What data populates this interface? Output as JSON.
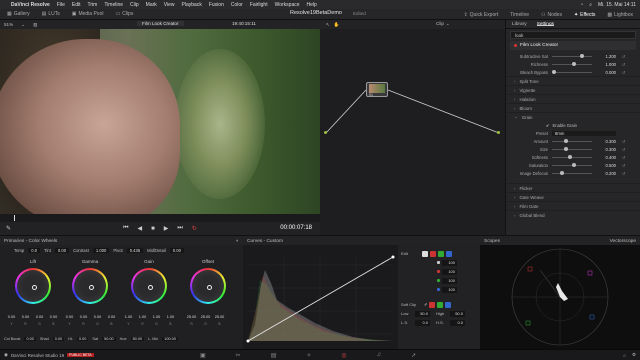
{
  "menubar": {
    "app": "DaVinci Resolve",
    "items": [
      "File",
      "Edit",
      "Trim",
      "Timeline",
      "Clip",
      "Mark",
      "View",
      "Playback",
      "Fusion",
      "Color",
      "Fairlight",
      "Workspace",
      "Help"
    ],
    "datetime": "Mi. 15. Mai 14:11"
  },
  "tabs": {
    "left": [
      "Gallery",
      "LUTs",
      "Media Pool",
      "Clips"
    ],
    "project_title": "Resolve19BetaDemo",
    "project_sub": "Edited",
    "right": [
      "Quick Export",
      "Timeline",
      "Nodes",
      "Effects",
      "Lightbox"
    ]
  },
  "viewer": {
    "zoom": "51%",
    "clip_name": "Film Look Creator",
    "timecode": "19:40:15:11",
    "playhead_tc": "00:00:07:18"
  },
  "nodes": {
    "clip_label": "Clip",
    "node_id": "01"
  },
  "panel": {
    "tabs": [
      "Library",
      "Settings"
    ],
    "search": "look",
    "effect_title": "Film Look Creator",
    "top_params": [
      {
        "label": "Subtractive Sat",
        "value": "1.200"
      },
      {
        "label": "Richness",
        "value": "1.000"
      },
      {
        "label": "Bleach Bypass",
        "value": "0.000"
      }
    ],
    "sections_a": [
      "Split Tone",
      "Vignette",
      "Halation",
      "Bloom",
      "Grain"
    ],
    "grain": {
      "enable_label": "Enable Grain",
      "preset_label": "Preset",
      "preset_value": "8mm",
      "params": [
        {
          "label": "Amount",
          "value": "0.300"
        },
        {
          "label": "Size",
          "value": "0.300"
        },
        {
          "label": "Softness",
          "value": "0.400"
        },
        {
          "label": "Saturation",
          "value": "0.500"
        },
        {
          "label": "Image Defocus",
          "value": "0.200"
        }
      ]
    },
    "sections_b": [
      "Flicker",
      "Gate Weave",
      "Film Gate",
      "Global Blend"
    ]
  },
  "primaries": {
    "title": "Primaries - Color Wheels",
    "top": [
      {
        "label": "Temp",
        "value": "0.0"
      },
      {
        "label": "Tint",
        "value": "0.00"
      },
      {
        "label": "Contrast",
        "value": "1.000"
      },
      {
        "label": "Pivot",
        "value": "0.435"
      },
      {
        "label": "Mid/Detail",
        "value": "0.00"
      }
    ],
    "wheels": [
      {
        "name": "Lift",
        "vals": [
          "0.00",
          "0.00",
          "0.00",
          "0.00"
        ]
      },
      {
        "name": "Gamma",
        "vals": [
          "0.00",
          "0.00",
          "0.00",
          "0.00"
        ]
      },
      {
        "name": "Gain",
        "vals": [
          "1.00",
          "1.00",
          "1.00",
          "1.00"
        ]
      },
      {
        "name": "Offset",
        "vals": [
          "25.00",
          "25.00",
          "25.00"
        ]
      }
    ],
    "channels": [
      "Y",
      "R",
      "G",
      "B"
    ],
    "bottom": [
      {
        "label": "Col Boost",
        "value": "0.00"
      },
      {
        "label": "Shad",
        "value": "0.00"
      },
      {
        "label": "HL",
        "value": "0.00"
      },
      {
        "label": "Sat",
        "value": "50.00"
      },
      {
        "label": "Hue",
        "value": "50.00"
      },
      {
        "label": "L. Mix",
        "value": "100.00"
      }
    ]
  },
  "curves": {
    "title": "Curves - Custom",
    "edit_label": "Edit",
    "edit_vals": [
      "100",
      "100",
      "100",
      "100"
    ],
    "softclip_label": "Soft Clip",
    "low_label": "Low",
    "low": "50.0",
    "high_label": "High",
    "high": "50.0",
    "ls_label": "L.S.",
    "ls": "0.0",
    "hs_label": "H.S.",
    "hs": "0.0"
  },
  "scopes": {
    "title": "Scopes",
    "mode": "Vectorscope"
  },
  "footer": {
    "app": "DaVinci Resolve Studio 19",
    "badge": "PUBLIC BETA"
  }
}
